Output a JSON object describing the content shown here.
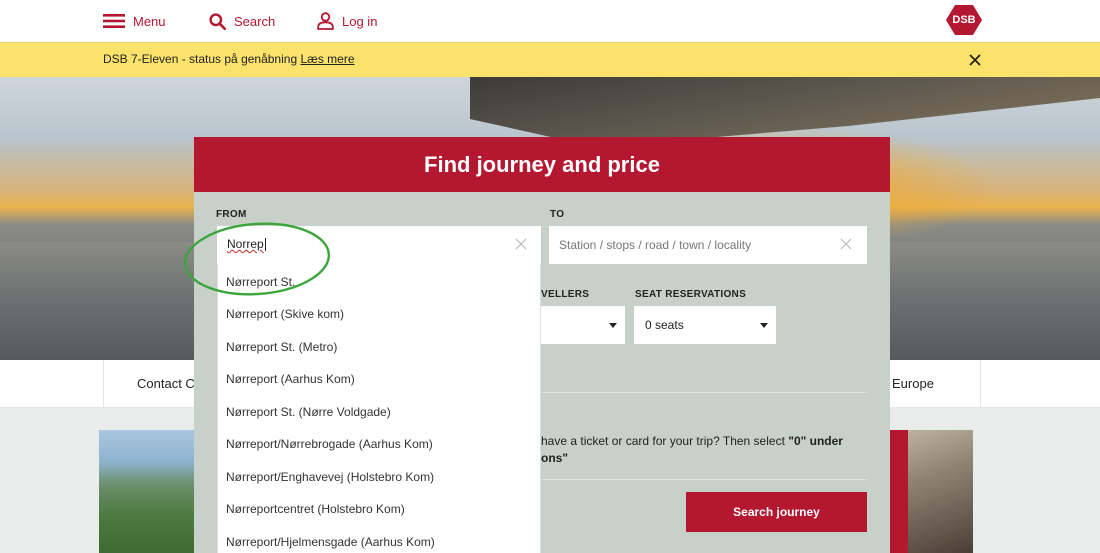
{
  "topnav": {
    "menu_label": "Menu",
    "search_label": "Search",
    "login_label": "Log in",
    "logo_text": "DSB",
    "brand_color": "#b41730"
  },
  "banner": {
    "text": "DSB 7-Eleven - status på genåbning",
    "link": "Læs mere",
    "background": "#fbe36b"
  },
  "journey": {
    "title": "Find journey and price",
    "from_label": "FROM",
    "from_value": "Norrep",
    "to_label": "TO",
    "to_placeholder": "Station / stops / road / town / locality",
    "travellers_label": "VELLERS",
    "seat_label": "SEAT RESERVATIONS",
    "seat_value": "0 seats",
    "info_text": "have a ticket or card for your trip? Then select",
    "info_bold_1": "\"0\" under",
    "info_bold_2": "ons\"",
    "search_button": "Search journey",
    "panel_color": "#c7d0c9"
  },
  "suggestions": [
    "Nørreport St.",
    "Nørreport (Skive kom)",
    "Nørreport St. (Metro)",
    "Nørreport (Aarhus Kom)",
    "Nørreport St. (Nørre Voldgade)",
    "Nørreport/Nørrebrogade (Aarhus Kom)",
    "Nørreport/Enghavevej (Holstebro Kom)",
    "Nørreportcentret (Holstebro Kom)",
    "Nørreport/Hjelmensgade (Aarhus Kom)"
  ],
  "subnav": {
    "left_item": "Contact C",
    "right_item": "Europe"
  },
  "annotation_color": "#3aa63a"
}
